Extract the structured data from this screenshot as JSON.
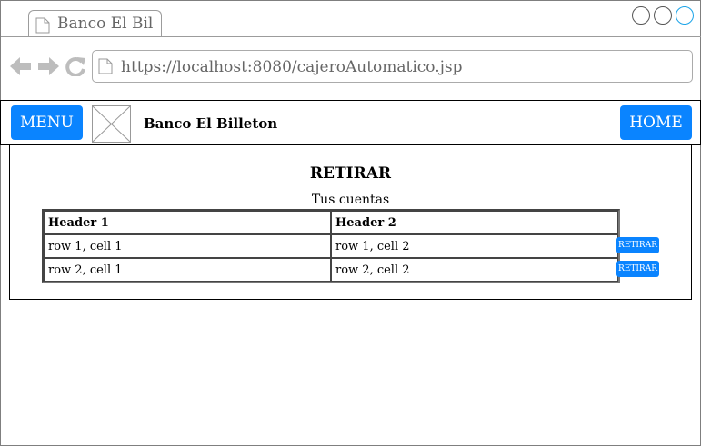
{
  "browser": {
    "tab_title": "Banco El Bil",
    "url": "https://localhost:8080/cajeroAutomatico.jsp"
  },
  "navbar": {
    "menu_label": "MENU",
    "brand": "Banco El Billeton",
    "home_label": "HOME"
  },
  "page": {
    "heading": "RETIRAR",
    "caption": "Tus cuentas"
  },
  "table": {
    "headers": [
      "Header 1",
      "Header 2"
    ],
    "rows": [
      [
        "row 1, cell 1",
        "row 1, cell 2"
      ],
      [
        "row 2, cell 1",
        "row 2, cell 2"
      ]
    ],
    "action_label": "RETIRAR"
  },
  "colors": {
    "accent": "#0a84ff",
    "active_window_button": "#1aa3e8"
  },
  "icons": [
    "document-icon",
    "back-arrow-icon",
    "forward-arrow-icon",
    "reload-icon",
    "image-placeholder-icon"
  ]
}
